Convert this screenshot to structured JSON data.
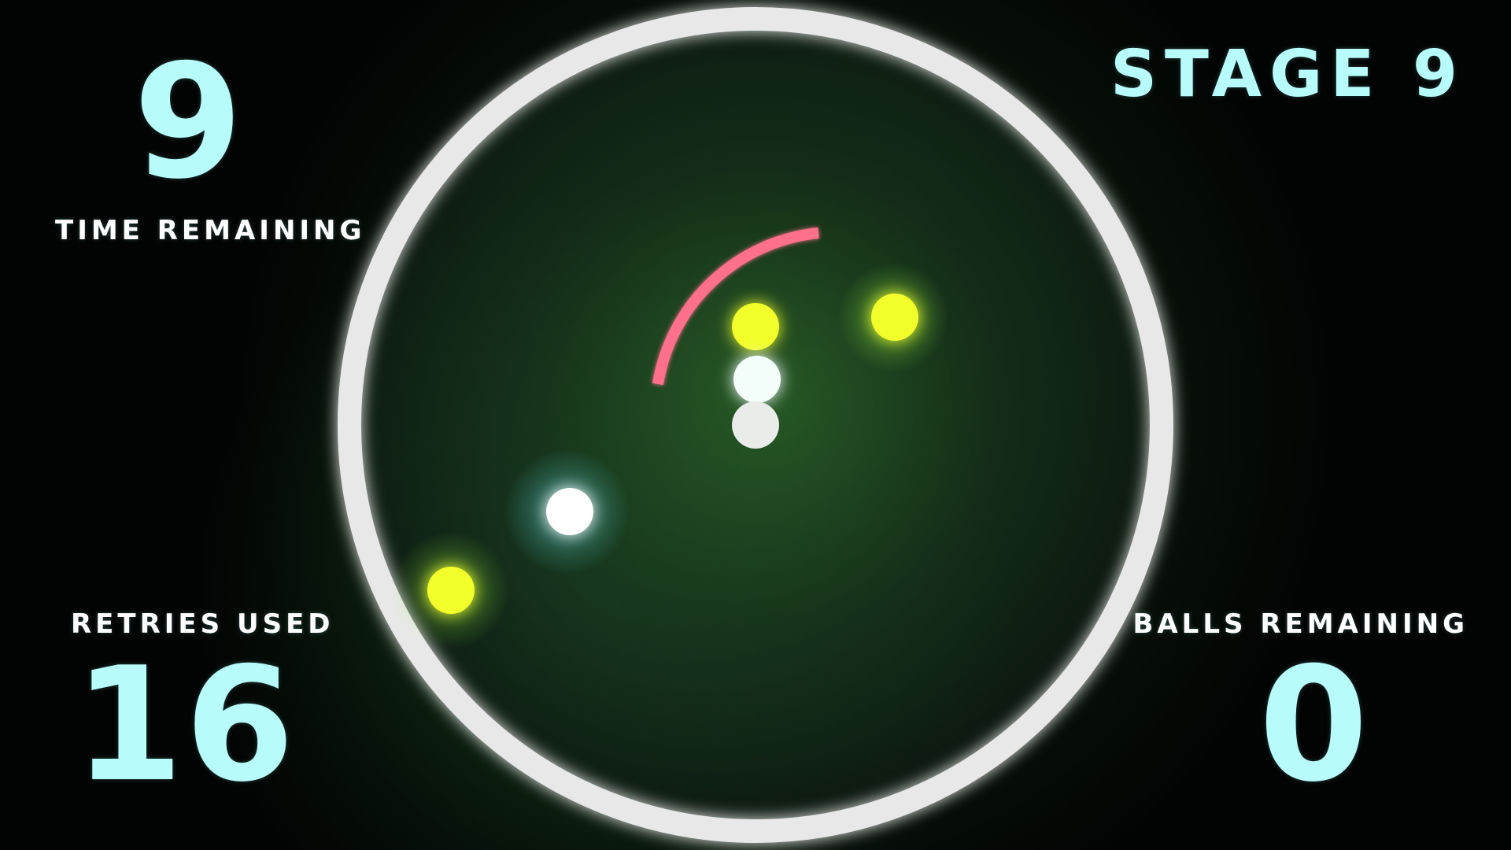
{
  "hud": {
    "time_remaining_value": "9",
    "time_remaining_label": "Time Remaining",
    "stage_label": "Stage 9",
    "retries_used_label": "Retries Used",
    "retries_used_value": "16",
    "balls_remaining_label": "Balls Remaining",
    "balls_remaining_value": "0"
  },
  "colors": {
    "hud_text": "#b8fbfb",
    "label_text": "#ffffff",
    "ring": "#e8e8e8",
    "paddle": "#ff6f8c",
    "ball_yellow": "#f2ff2a",
    "ball_white": "#f4fffb",
    "ball_cyan_glow": "#72f7ff"
  },
  "game": {
    "arena_shape": "circle",
    "paddle_icon": "curved-paddle",
    "balls": [
      {
        "kind": "yellow",
        "icon": "yellow-ball"
      },
      {
        "kind": "yellow",
        "icon": "yellow-ball"
      },
      {
        "kind": "yellow",
        "icon": "yellow-ball"
      },
      {
        "kind": "white",
        "icon": "white-ball"
      },
      {
        "kind": "white",
        "icon": "white-ball"
      },
      {
        "kind": "white-cyan",
        "icon": "glowing-white-ball"
      }
    ]
  }
}
